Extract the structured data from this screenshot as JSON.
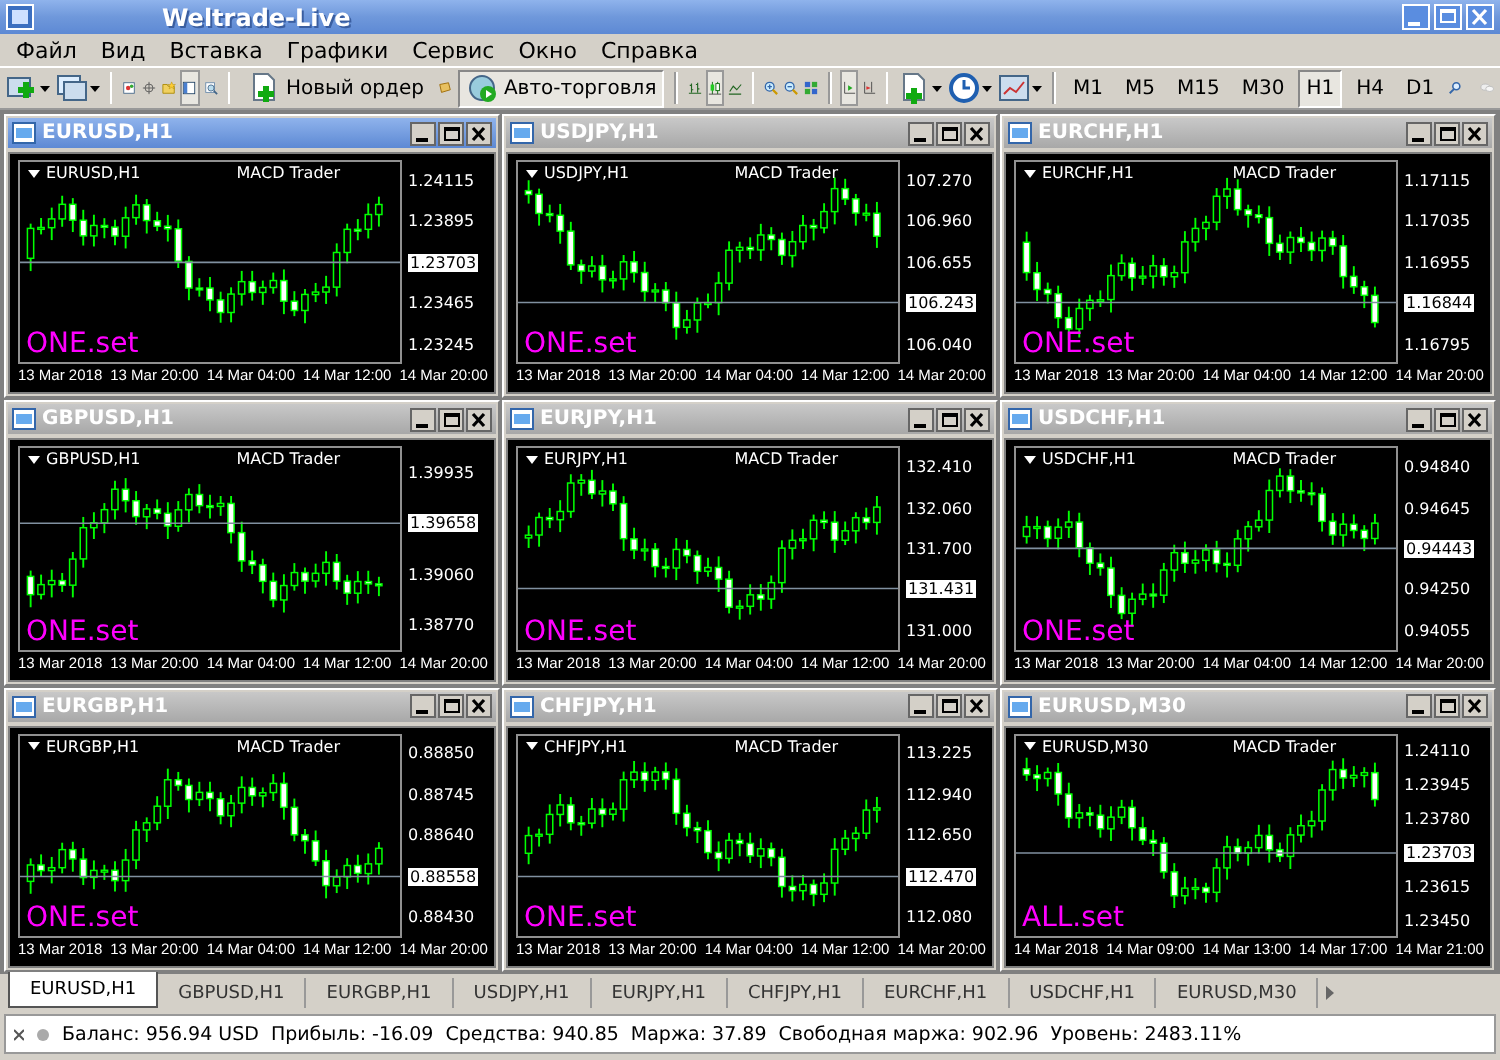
{
  "window": {
    "title": "Weltrade-Live"
  },
  "menu": [
    "Файл",
    "Вид",
    "Вставка",
    "Графики",
    "Сервис",
    "Окно",
    "Справка"
  ],
  "toolbar": {
    "new_order": "Новый ордер",
    "auto_trading": "Авто-торговля",
    "timeframes": [
      {
        "label": "M1",
        "selected": false
      },
      {
        "label": "M5",
        "selected": false
      },
      {
        "label": "M15",
        "selected": false
      },
      {
        "label": "M30",
        "selected": false
      },
      {
        "label": "H1",
        "selected": true
      },
      {
        "label": "H4",
        "selected": false
      },
      {
        "label": "D1",
        "selected": false
      }
    ]
  },
  "charts": [
    {
      "title": "EURUSD,H1",
      "active": true,
      "symbol": "EURUSD,H1",
      "expert": "MACD Trader",
      "set": "ONE.set",
      "prices": [
        {
          "value": "1.24115",
          "kind": "tick"
        },
        {
          "value": "1.23895",
          "kind": "tick"
        },
        {
          "value": "1.23703",
          "kind": "current"
        },
        {
          "value": "1.23465",
          "kind": "tick"
        },
        {
          "value": "1.23245",
          "kind": "tick"
        }
      ],
      "times": [
        "13 Mar 2018",
        "13 Mar 20:00",
        "14 Mar 04:00",
        "14 Mar 12:00",
        "14 Mar 20:00"
      ]
    },
    {
      "title": "USDJPY,H1",
      "active": false,
      "symbol": "USDJPY,H1",
      "expert": "MACD Trader",
      "set": "ONE.set",
      "prices": [
        {
          "value": "107.270",
          "kind": "tick"
        },
        {
          "value": "106.960",
          "kind": "tick"
        },
        {
          "value": "106.655",
          "kind": "tick"
        },
        {
          "value": "106.243",
          "kind": "current"
        },
        {
          "value": "106.040",
          "kind": "tick"
        }
      ],
      "times": [
        "13 Mar 2018",
        "13 Mar 20:00",
        "14 Mar 04:00",
        "14 Mar 12:00",
        "14 Mar 20:00"
      ]
    },
    {
      "title": "EURCHF,H1",
      "active": false,
      "symbol": "EURCHF,H1",
      "expert": "MACD Trader",
      "set": "ONE.set",
      "prices": [
        {
          "value": "1.17115",
          "kind": "tick"
        },
        {
          "value": "1.17035",
          "kind": "tick"
        },
        {
          "value": "1.16955",
          "kind": "tick"
        },
        {
          "value": "1.16844",
          "kind": "current"
        },
        {
          "value": "1.16795",
          "kind": "tick"
        }
      ],
      "times": [
        "13 Mar 2018",
        "13 Mar 20:00",
        "14 Mar 04:00",
        "14 Mar 12:00",
        "14 Mar 20:00"
      ]
    },
    {
      "title": "GBPUSD,H1",
      "active": false,
      "symbol": "GBPUSD,H1",
      "expert": "MACD Trader",
      "set": "ONE.set",
      "prices": [
        {
          "value": "1.39935",
          "kind": "tick"
        },
        {
          "value": "1.39658",
          "kind": "current"
        },
        {
          "value": "1.39060",
          "kind": "tick"
        },
        {
          "value": "1.38770",
          "kind": "tick"
        }
      ],
      "times": [
        "13 Mar 2018",
        "13 Mar 20:00",
        "14 Mar 04:00",
        "14 Mar 12:00",
        "14 Mar 20:00"
      ]
    },
    {
      "title": "EURJPY,H1",
      "active": false,
      "symbol": "EURJPY,H1",
      "expert": "MACD Trader",
      "set": "ONE.set",
      "prices": [
        {
          "value": "132.410",
          "kind": "tick"
        },
        {
          "value": "132.060",
          "kind": "tick"
        },
        {
          "value": "131.700",
          "kind": "tick"
        },
        {
          "value": "131.431",
          "kind": "current"
        },
        {
          "value": "131.000",
          "kind": "tick"
        }
      ],
      "times": [
        "13 Mar 2018",
        "13 Mar 20:00",
        "14 Mar 04:00",
        "14 Mar 12:00",
        "14 Mar 20:00"
      ]
    },
    {
      "title": "USDCHF,H1",
      "active": false,
      "symbol": "USDCHF,H1",
      "expert": "MACD Trader",
      "set": "ONE.set",
      "prices": [
        {
          "value": "0.94840",
          "kind": "tick"
        },
        {
          "value": "0.94645",
          "kind": "tick"
        },
        {
          "value": "0.94443",
          "kind": "current"
        },
        {
          "value": "0.94250",
          "kind": "tick"
        },
        {
          "value": "0.94055",
          "kind": "tick"
        }
      ],
      "times": [
        "13 Mar 2018",
        "13 Mar 20:00",
        "14 Mar 04:00",
        "14 Mar 12:00",
        "14 Mar 20:00"
      ]
    },
    {
      "title": "EURGBP,H1",
      "active": false,
      "symbol": "EURGBP,H1",
      "expert": "MACD Trader",
      "set": "ONE.set",
      "prices": [
        {
          "value": "0.88850",
          "kind": "tick"
        },
        {
          "value": "0.88745",
          "kind": "tick"
        },
        {
          "value": "0.88640",
          "kind": "tick"
        },
        {
          "value": "0.88558",
          "kind": "current"
        },
        {
          "value": "0.88430",
          "kind": "tick"
        }
      ],
      "times": [
        "13 Mar 2018",
        "13 Mar 20:00",
        "14 Mar 04:00",
        "14 Mar 12:00",
        "14 Mar 20:00"
      ]
    },
    {
      "title": "CHFJPY,H1",
      "active": false,
      "symbol": "CHFJPY,H1",
      "expert": "MACD Trader",
      "set": "ONE.set",
      "prices": [
        {
          "value": "113.225",
          "kind": "tick"
        },
        {
          "value": "112.940",
          "kind": "tick"
        },
        {
          "value": "112.650",
          "kind": "tick"
        },
        {
          "value": "112.470",
          "kind": "current"
        },
        {
          "value": "112.080",
          "kind": "tick"
        }
      ],
      "times": [
        "13 Mar 2018",
        "13 Mar 20:00",
        "14 Mar 04:00",
        "14 Mar 12:00",
        "14 Mar 20:00"
      ]
    },
    {
      "title": "EURUSD,M30",
      "active": false,
      "symbol": "EURUSD,M30",
      "expert": "MACD Trader",
      "set": "ALL.set",
      "prices": [
        {
          "value": "1.24110",
          "kind": "tick"
        },
        {
          "value": "1.23945",
          "kind": "tick"
        },
        {
          "value": "1.23780",
          "kind": "tick"
        },
        {
          "value": "1.23703",
          "kind": "current"
        },
        {
          "value": "1.23615",
          "kind": "tick"
        },
        {
          "value": "1.23450",
          "kind": "tick"
        }
      ],
      "times": [
        "14 Mar 2018",
        "14 Mar 09:00",
        "14 Mar 13:00",
        "14 Mar 17:00",
        "14 Mar 21:00"
      ]
    }
  ],
  "tabs": [
    {
      "label": "EURUSD,H1",
      "selected": true
    },
    {
      "label": "GBPUSD,H1",
      "selected": false
    },
    {
      "label": "EURGBP,H1",
      "selected": false
    },
    {
      "label": "USDJPY,H1",
      "selected": false
    },
    {
      "label": "EURJPY,H1",
      "selected": false
    },
    {
      "label": "CHFJPY,H1",
      "selected": false
    },
    {
      "label": "EURCHF,H1",
      "selected": false
    },
    {
      "label": "USDCHF,H1",
      "selected": false
    },
    {
      "label": "EURUSD,M30",
      "selected": false
    }
  ],
  "status": [
    "Баланс: 956.94 USD",
    "Прибыль: -16.09",
    "Средства: 940.85",
    "Маржа: 37.89",
    "Свободная маржа: 902.96",
    "Уровень: 2483.11%"
  ]
}
